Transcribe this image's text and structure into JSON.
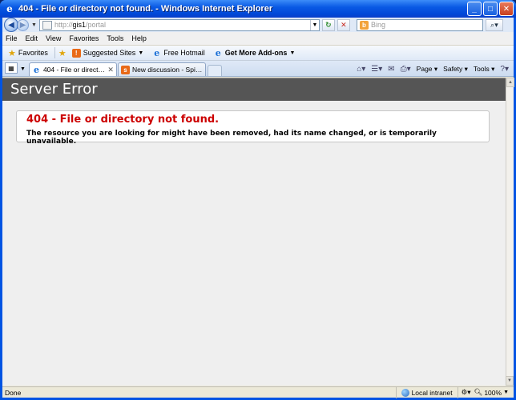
{
  "window": {
    "title": "404 - File or directory not found. - Windows Internet Explorer"
  },
  "address": {
    "url_prefix": "http://",
    "url_host": "gis1",
    "url_path": "/portal",
    "search_placeholder": "Bing"
  },
  "menu": {
    "items": [
      {
        "label": "File"
      },
      {
        "label": "Edit"
      },
      {
        "label": "View"
      },
      {
        "label": "Favorites"
      },
      {
        "label": "Tools"
      },
      {
        "label": "Help"
      }
    ]
  },
  "favorites_bar": {
    "favorites_label": "Favorites",
    "suggested_sites_label": "Suggested Sites",
    "free_hotmail_label": "Free Hotmail",
    "get_addons_label": "Get More Add-ons"
  },
  "tabs": [
    {
      "label": "404 - File or directory not f...",
      "active": true
    },
    {
      "label": "New discussion - Spiceworks ...",
      "active": false
    }
  ],
  "command_bar": {
    "page_label": "Page",
    "safety_label": "Safety",
    "tools_label": "Tools"
  },
  "page": {
    "header": "Server Error",
    "error_title": "404 - File or directory not found.",
    "error_message": "The resource you are looking for might have been removed, had its name changed, or is temporarily unavailable."
  },
  "status": {
    "text": "Done",
    "zone": "Local intranet",
    "zoom": "100%"
  }
}
